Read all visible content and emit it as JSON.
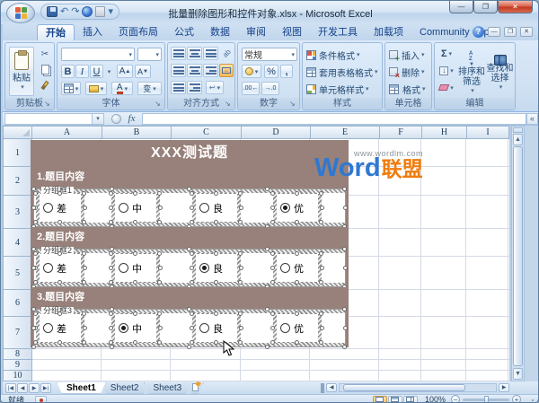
{
  "window": {
    "title": "批量删除图形和控件对象.xlsx - Microsoft Excel"
  },
  "ribbon": {
    "tabs": [
      "开始",
      "插入",
      "页面布局",
      "公式",
      "数据",
      "审阅",
      "视图",
      "开发工具",
      "加载项",
      "Community Clips"
    ],
    "clipboard": {
      "label": "剪贴板",
      "paste": "粘贴"
    },
    "font": {
      "label": "字体",
      "bold": "B",
      "italic": "I",
      "underline": "U",
      "phonetic": "变"
    },
    "alignment": {
      "label": "对齐方式"
    },
    "number": {
      "label": "数字",
      "format": "常规",
      "percent": "%",
      "comma": ",",
      "dec_inc": ".00",
      "dec_dec": ".0"
    },
    "styles": {
      "label": "样式",
      "conditional": "条件格式",
      "table": "套用表格格式",
      "cell": "单元格样式"
    },
    "cells": {
      "label": "单元格",
      "insert": "插入",
      "delete": "删除",
      "format": "格式"
    },
    "editing": {
      "label": "编辑",
      "sum": "Σ",
      "sort": "排序和筛选",
      "find": "查找和选择"
    }
  },
  "formula_bar": {
    "fx": "fx"
  },
  "grid": {
    "columns": [
      "A",
      "B",
      "C",
      "D",
      "E",
      "F",
      "H",
      "I"
    ],
    "rows": [
      "1",
      "2",
      "3",
      "4",
      "5",
      "6",
      "7",
      "8",
      "9",
      "10"
    ],
    "title": "XXX测试题",
    "sections": [
      {
        "header": "1.题目内容",
        "group_label": "分组框1",
        "options": [
          {
            "label": "差",
            "selected": false
          },
          {
            "label": "中",
            "selected": false
          },
          {
            "label": "良",
            "selected": false
          },
          {
            "label": "优",
            "selected": true
          }
        ]
      },
      {
        "header": "2.题目内容",
        "group_label": "分组框2",
        "options": [
          {
            "label": "差",
            "selected": false
          },
          {
            "label": "中",
            "selected": false
          },
          {
            "label": "良",
            "selected": true
          },
          {
            "label": "优",
            "selected": false
          }
        ]
      },
      {
        "header": "3.题目内容",
        "group_label": "分组框3",
        "options": [
          {
            "label": "差",
            "selected": false
          },
          {
            "label": "中",
            "selected": true
          },
          {
            "label": "良",
            "selected": false
          },
          {
            "label": "优",
            "selected": false
          }
        ]
      }
    ],
    "watermark": {
      "url": "www.wordlm.com",
      "brand_en": "Word",
      "brand_cn": "联盟"
    }
  },
  "sheet_bar": {
    "tabs": [
      "Sheet1",
      "Sheet2",
      "Sheet3"
    ]
  },
  "status_bar": {
    "ready": "就绪",
    "zoom": "100%"
  },
  "colors": {
    "band": "#97817a",
    "watermark_blue": "#2e78d2",
    "watermark_orange": "#f07c0c",
    "highlight_orange": "#f9c878"
  }
}
